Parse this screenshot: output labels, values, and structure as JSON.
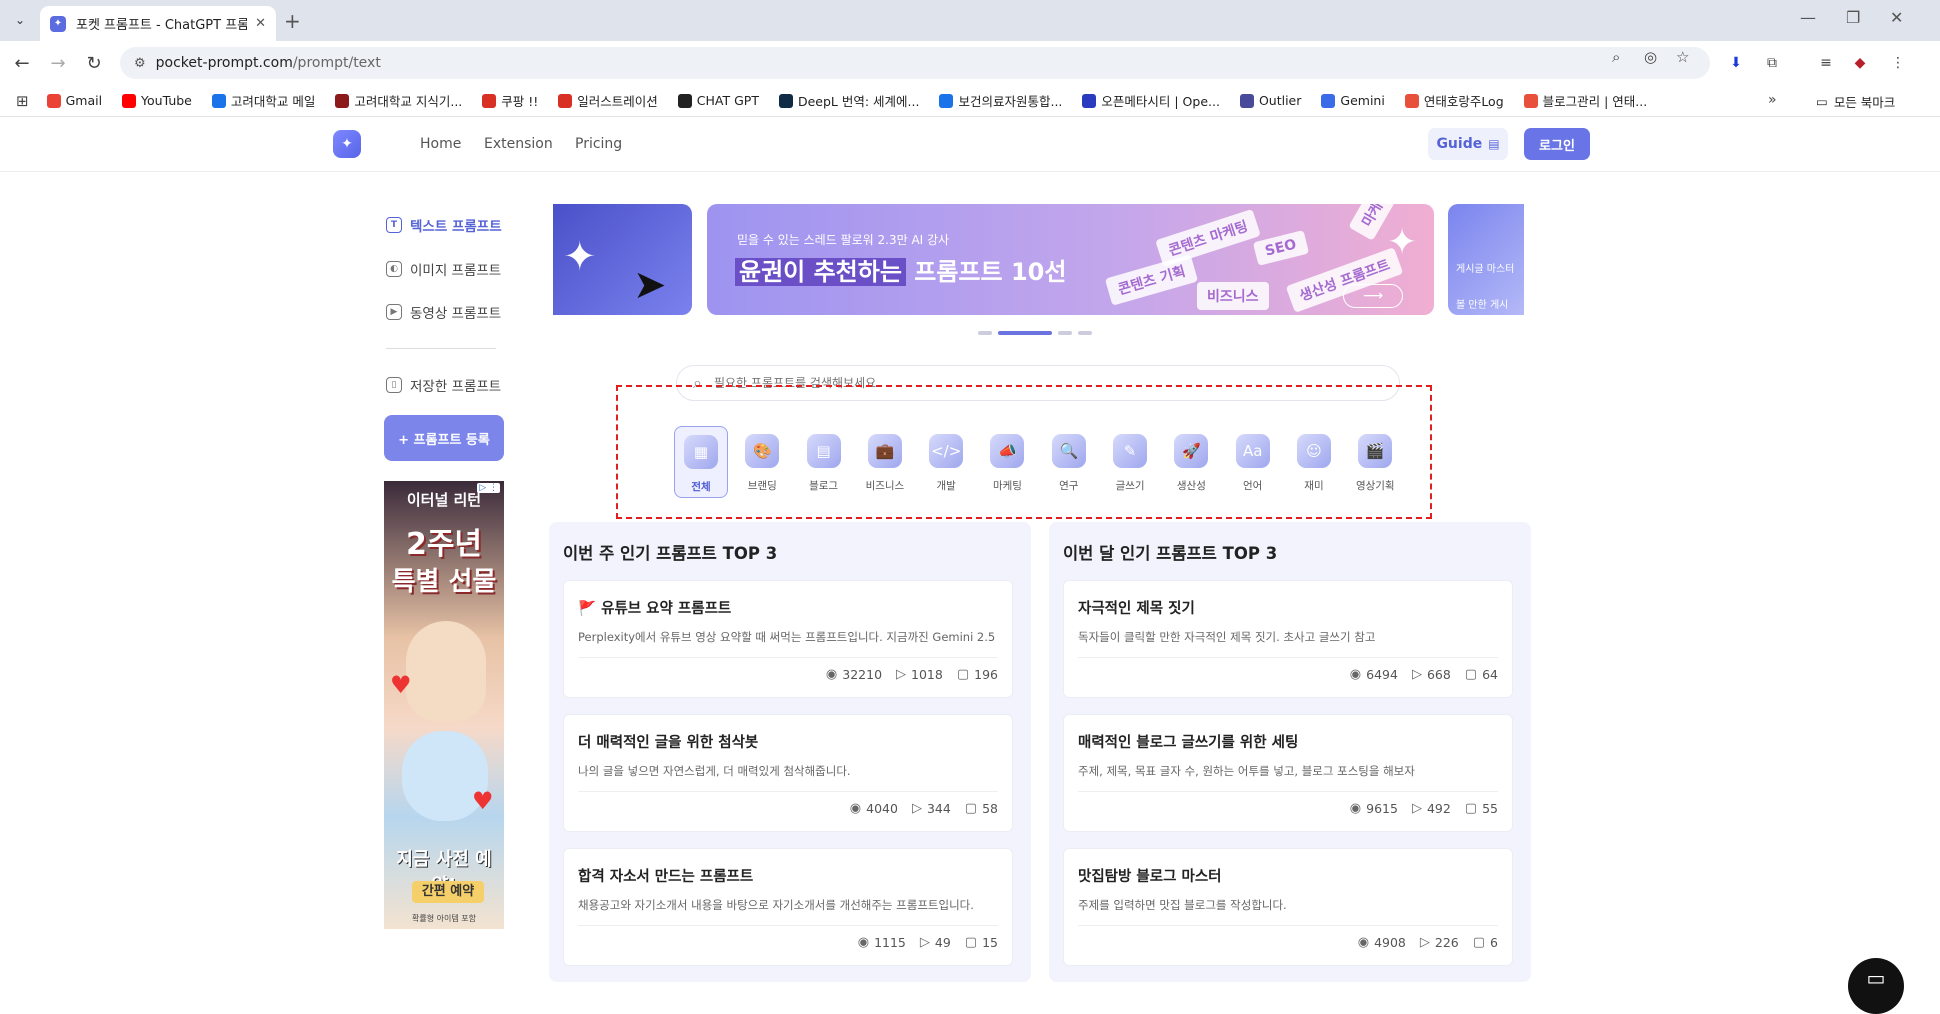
{
  "browser": {
    "tab_title": "포켓 프롬프트 - ChatGPT 프롬프트",
    "url_domain": "pocket-prompt.com",
    "url_path": "/prompt/text",
    "bookmarks": [
      {
        "label": "Gmail",
        "icon": "gmail-icon",
        "color": "#ea4335"
      },
      {
        "label": "YouTube",
        "icon": "youtube-icon",
        "color": "#ff0000"
      },
      {
        "label": "고려대학교 메일",
        "icon": "mail-icon",
        "color": "#1a73e8"
      },
      {
        "label": "고려대학교 지식기...",
        "icon": "university-icon",
        "color": "#8b1a1a"
      },
      {
        "label": "쿠팡 !!",
        "icon": "shop-icon",
        "color": "#d93025"
      },
      {
        "label": "일러스트레이션",
        "icon": "illust-icon",
        "color": "#d93025"
      },
      {
        "label": "CHAT GPT",
        "icon": "chatgpt-icon",
        "color": "#222222"
      },
      {
        "label": "DeepL 번역: 세계에...",
        "icon": "deepl-icon",
        "color": "#0f2b46"
      },
      {
        "label": "보건의료자원통합...",
        "icon": "health-icon",
        "color": "#1a73e8"
      },
      {
        "label": "오픈메타시티 | Ope...",
        "icon": "meta-icon",
        "color": "#2a3bbf"
      },
      {
        "label": "Outlier",
        "icon": "outlier-icon",
        "color": "#4a4a9a"
      },
      {
        "label": "Gemini",
        "icon": "gemini-icon",
        "color": "#3b6be8"
      },
      {
        "label": "연태호랑주Log",
        "icon": "blog-icon",
        "color": "#e8503b"
      },
      {
        "label": "블로그관리 | 연태...",
        "icon": "blog-icon",
        "color": "#e8503b"
      }
    ],
    "all_bookmarks": "모든 북마크"
  },
  "header": {
    "nav": [
      "Home",
      "Extension",
      "Pricing"
    ],
    "guide": "Guide",
    "login": "로그인"
  },
  "sidebar": {
    "items": [
      {
        "label": "텍스트 프롬프트",
        "icon": "text-icon",
        "active": true
      },
      {
        "label": "이미지 프롬프트",
        "icon": "image-icon",
        "active": false
      },
      {
        "label": "동영상 프롬프트",
        "icon": "video-icon",
        "active": false
      }
    ],
    "saved": "저장한 프롬프트",
    "register": "+ 프롬프트 등록",
    "ad": {
      "line1": "이터널 리턴",
      "line2": "2주년",
      "line3": "특별 선물",
      "cta": "지금 사전 예약!",
      "button": "간편 예약",
      "footer": "확률형 아이템 포함"
    }
  },
  "banner": {
    "sub": "믿을 수 있는 스레드 팔로워 2.3만 AI 강사",
    "main_highlight": "윤권이 추천하는",
    "main_rest": " 프롬프트 10선",
    "chips": [
      "콘텐츠 마케팅",
      "SEO",
      "생산성 프롬프트",
      "콘텐츠 기획",
      "비즈니스",
      "마케"
    ],
    "right_lines": [
      "게시글 마스터",
      "볼 만한 게시"
    ]
  },
  "search": {
    "placeholder": "필요한 프롬프트를 검색해보세요"
  },
  "categories": [
    {
      "label": "전체",
      "icon": "all-icon",
      "glyph": "▦",
      "active": true
    },
    {
      "label": "브랜딩",
      "icon": "palette-icon",
      "glyph": "🎨",
      "active": false
    },
    {
      "label": "블로그",
      "icon": "blog-icon",
      "glyph": "▤",
      "active": false
    },
    {
      "label": "비즈니스",
      "icon": "briefcase-icon",
      "glyph": "💼",
      "active": false
    },
    {
      "label": "개발",
      "icon": "code-icon",
      "glyph": "</>",
      "active": false
    },
    {
      "label": "마케팅",
      "icon": "megaphone-icon",
      "glyph": "📣",
      "active": false
    },
    {
      "label": "연구",
      "icon": "magnifier-icon",
      "glyph": "🔍",
      "active": false
    },
    {
      "label": "글쓰기",
      "icon": "pencil-icon",
      "glyph": "✎",
      "active": false
    },
    {
      "label": "생산성",
      "icon": "rocket-icon",
      "glyph": "🚀",
      "active": false
    },
    {
      "label": "언어",
      "icon": "language-icon",
      "glyph": "Aa",
      "active": false
    },
    {
      "label": "재미",
      "icon": "smile-icon",
      "glyph": "☺",
      "active": false
    },
    {
      "label": "영상기획",
      "icon": "clapper-icon",
      "glyph": "🎬",
      "active": false
    }
  ],
  "weekly": {
    "title": "이번 주 인기 프롬프트 TOP 3",
    "cards": [
      {
        "title": "🚩 유튜브 요약 프롬프트",
        "desc": "Perplexity에서 유튜브 영상 요약할 때 써먹는 프롬프트입니다. 지금까진 Gemini 2.5 ...",
        "views": "32210",
        "uses": "1018",
        "saves": "196"
      },
      {
        "title": "더 매력적인 글을 위한 첨삭봇",
        "desc": "나의 글을 넣으면 자연스럽게, 더 매력있게 첨삭해줍니다.",
        "views": "4040",
        "uses": "344",
        "saves": "58"
      },
      {
        "title": "합격 자소서 만드는 프롬프트",
        "desc": "채용공고와 자기소개서 내용을 바탕으로 자기소개서를 개선해주는 프롬프트입니다.",
        "views": "1115",
        "uses": "49",
        "saves": "15"
      }
    ]
  },
  "monthly": {
    "title": "이번 달 인기 프롬프트 TOP 3",
    "cards": [
      {
        "title": "자극적인 제목 짓기",
        "desc": "독자들이 클릭할 만한 자극적인 제목 짓기. 초사고 글쓰기 참고",
        "views": "6494",
        "uses": "668",
        "saves": "64"
      },
      {
        "title": "매력적인 블로그 글쓰기를 위한 세팅",
        "desc": "주제, 제목, 목표 글자 수, 원하는 어투를 넣고, 블로그 포스팅을 해보자",
        "views": "9615",
        "uses": "492",
        "saves": "55"
      },
      {
        "title": "맛집탐방 블로그 마스터",
        "desc": "주제를 입력하면 맛집 블로그를 작성합니다.",
        "views": "4908",
        "uses": "226",
        "saves": "6"
      }
    ]
  },
  "colors": {
    "accent": "#6974e6",
    "highlight_border": "#e02020"
  }
}
